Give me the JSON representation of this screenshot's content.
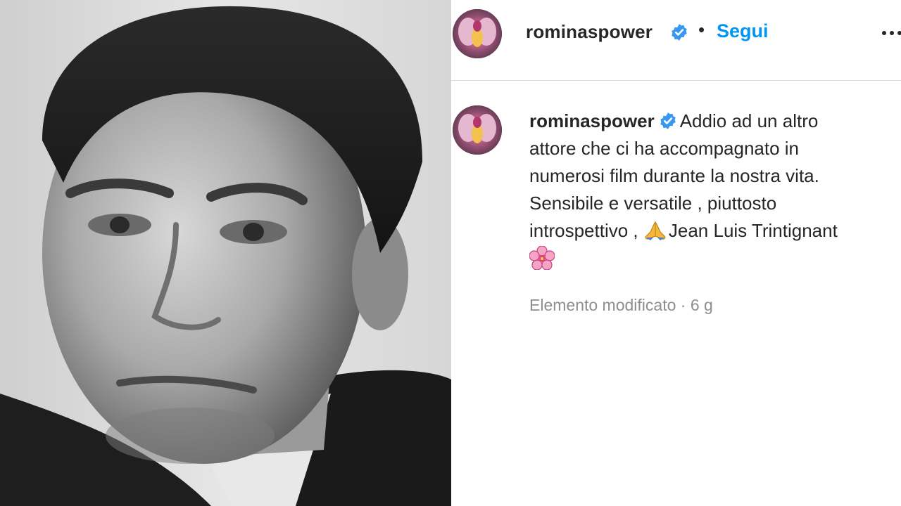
{
  "post": {
    "username": "rominaspower",
    "verified": true,
    "follow_label": "Segui",
    "separator": "•",
    "caption_lines": [
      "Addio ad un altro",
      "attore che ci ha accompagnato in",
      "numerosi film durante la nostra vita.",
      "Sensibile e versatile , piuttosto",
      "introspettivo ,",
      "Jean Luis Trintignant"
    ],
    "caption_emojis": [
      "pray-hands-emoji",
      "cherry-blossom-emoji"
    ],
    "meta": "Elemento modificato · 6 g"
  },
  "colors": {
    "link": "#0095f6",
    "text": "#262626",
    "muted": "#8e8e8e",
    "verified": "#3897f0",
    "divider": "#dbdbdb"
  }
}
